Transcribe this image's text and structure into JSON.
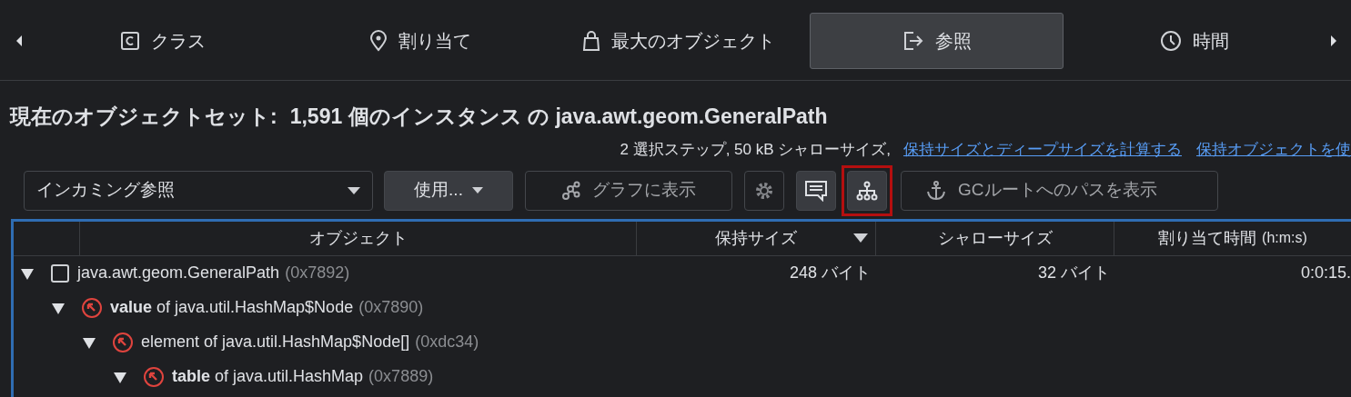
{
  "tabs": [
    {
      "label": "クラス",
      "selected": false
    },
    {
      "label": "割り当て",
      "selected": false
    },
    {
      "label": "最大のオブジェクト",
      "selected": false
    },
    {
      "label": "参照",
      "selected": true
    },
    {
      "label": "時間",
      "selected": false
    }
  ],
  "title": {
    "label": "現在のオブジェクトセット:",
    "value": "1,591 個のインスタンス の java.awt.geom.GeneralPath"
  },
  "summary": {
    "text": "2 選択ステップ, 50 kB シャローサイズ,",
    "links": [
      "保持サイズとディープサイズを計算する",
      "保持オブジェクトを使"
    ]
  },
  "toolbar": [
    {
      "kind": "dropdown",
      "label": "インカミング参照",
      "disabled": false,
      "selected": false,
      "highlighted": false
    },
    {
      "kind": "menu",
      "label": "使用...",
      "disabled": false,
      "selected": true,
      "highlighted": false
    },
    {
      "kind": "button",
      "label": "グラフに表示",
      "disabled": true,
      "selected": false,
      "highlighted": false
    },
    {
      "kind": "icon",
      "disabled": true,
      "selected": false,
      "highlighted": false
    },
    {
      "kind": "icon",
      "disabled": false,
      "selected": true,
      "highlighted": false
    },
    {
      "kind": "icon",
      "disabled": false,
      "selected": true,
      "highlighted": true
    },
    {
      "kind": "button",
      "label": "GCルートへのパスを表示",
      "disabled": true,
      "selected": false,
      "highlighted": false
    }
  ],
  "table": {
    "columns": [
      {
        "label": "オブジェクト",
        "sorted": false
      },
      {
        "label": "保持サイズ",
        "sorted": true
      },
      {
        "label": "シャローサイズ",
        "sorted": false
      },
      {
        "label": "割り当て時間",
        "unit": "(h:m:s)",
        "sorted": false
      }
    ],
    "rows": [
      {
        "kind": "object",
        "name": "java.awt.geom.GeneralPath",
        "address": "(0x7892)",
        "retained": "248 バイト",
        "shallow": "32 バイト",
        "time": "0:0:15.",
        "expanded": true,
        "children": [
          {
            "kind": "reference",
            "name": "**value** of java.util.HashMap$Node",
            "address": "(0x7890)",
            "expanded": true,
            "children": [
              {
                "kind": "reference",
                "name": "element of java.util.HashMap$Node[]",
                "address": "(0xdc34)",
                "expanded": true,
                "children": [
                  {
                    "kind": "reference",
                    "name": "**table** of java.util.HashMap",
                    "address": "(0x7889)",
                    "expanded": true
                  }
                ]
              }
            ]
          }
        ]
      }
    ]
  }
}
